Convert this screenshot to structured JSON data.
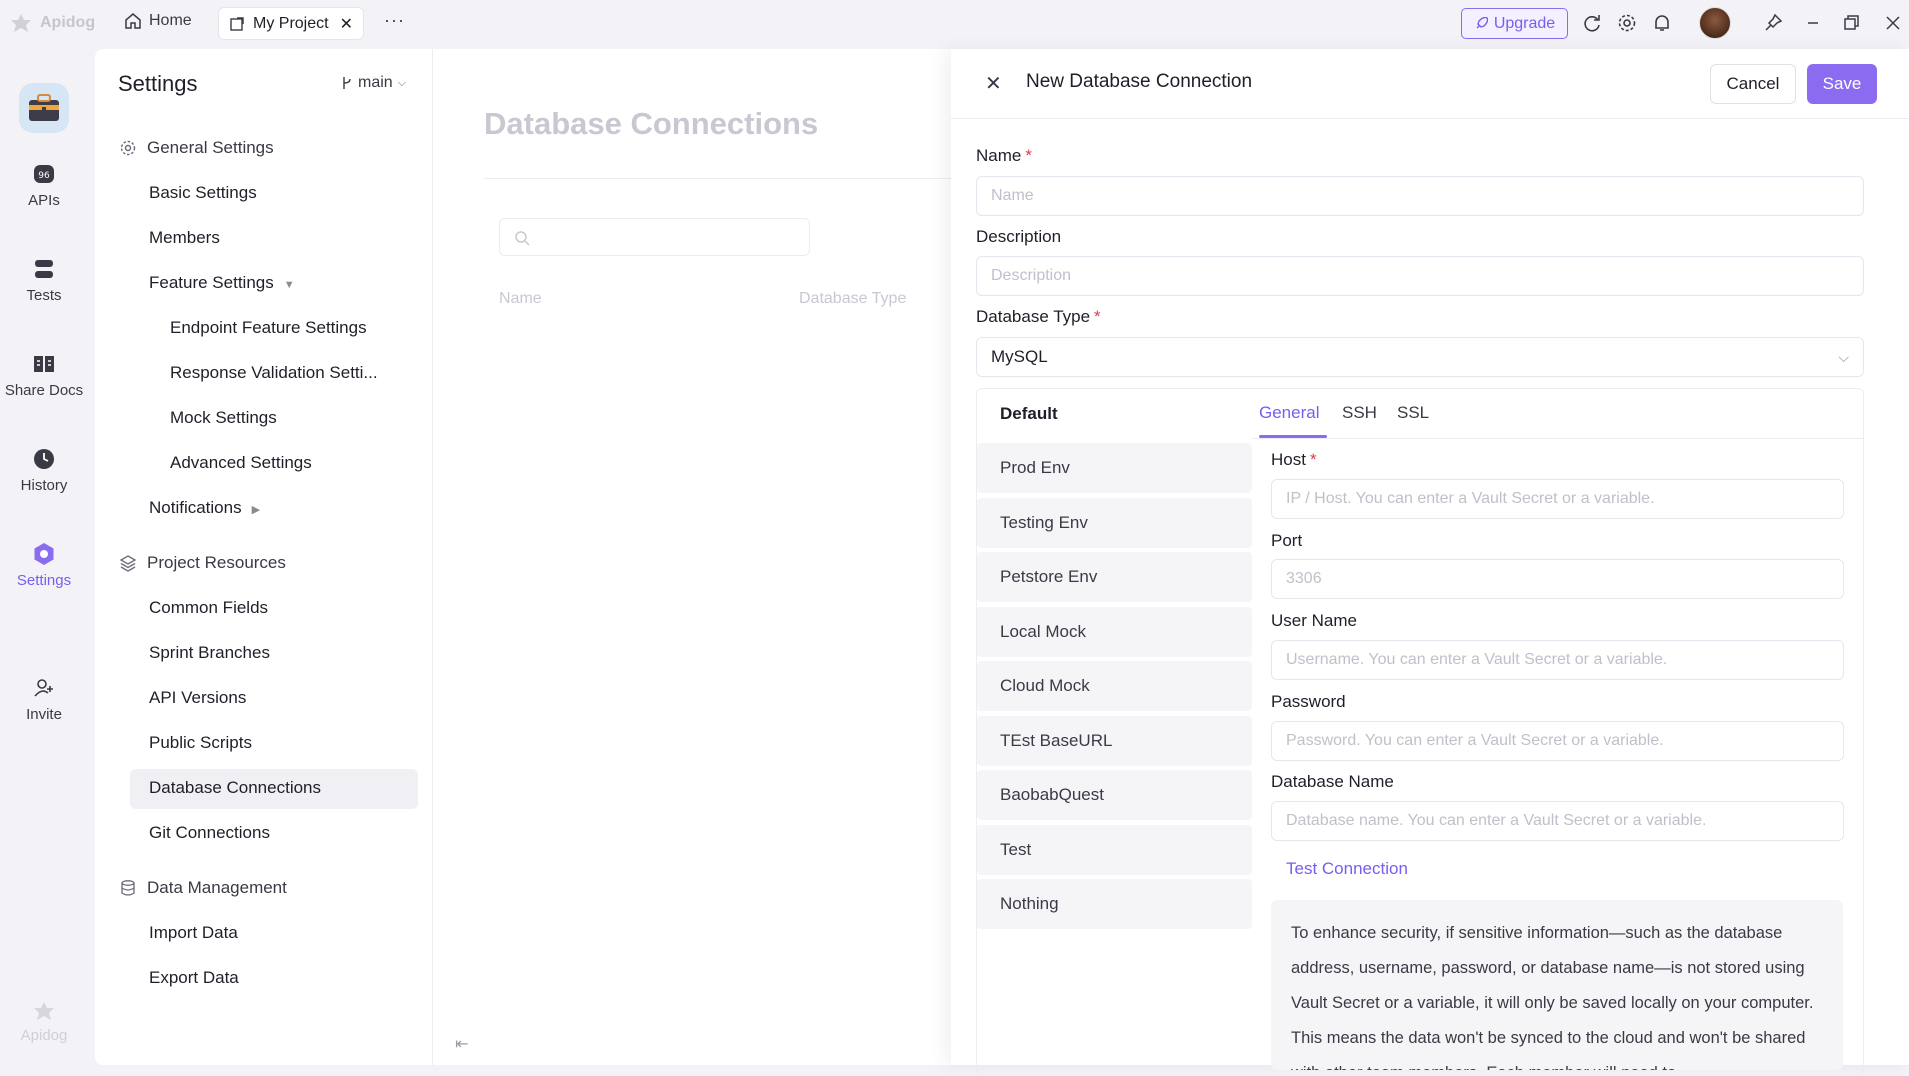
{
  "titlebar": {
    "logo_text": "Apidog",
    "home_label": "Home",
    "tab_label": "My Project",
    "tab_close": "✕",
    "more": "···",
    "upgrade_label": "Upgrade"
  },
  "rail": {
    "items": [
      {
        "label": "APIs",
        "icon": "apis-icon"
      },
      {
        "label": "Tests",
        "icon": "tests-icon"
      },
      {
        "label": "Share Docs",
        "icon": "share-docs-icon"
      },
      {
        "label": "History",
        "icon": "history-icon"
      },
      {
        "label": "Settings",
        "icon": "settings-icon",
        "active": true
      },
      {
        "label": "Invite",
        "icon": "invite-icon"
      }
    ],
    "bottom_logo": "Apidog"
  },
  "settings": {
    "title": "Settings",
    "branch": "main",
    "general_group": "General Settings",
    "general_items": [
      "Basic Settings",
      "Members",
      "Feature Settings"
    ],
    "feature_sub": [
      "Endpoint Feature Settings",
      "Response Validation Setti...",
      "Mock Settings",
      "Advanced Settings"
    ],
    "notifications": "Notifications",
    "resources_group": "Project Resources",
    "resources_items": [
      "Common Fields",
      "Sprint Branches",
      "API Versions",
      "Public Scripts",
      "Database Connections",
      "Git Connections"
    ],
    "data_group": "Data Management",
    "data_items": [
      "Import Data",
      "Export Data"
    ]
  },
  "background": {
    "title": "Database Connections",
    "col_name": "Name",
    "col_type": "Database Type"
  },
  "drawer": {
    "title": "New Database Connection",
    "cancel": "Cancel",
    "save": "Save",
    "name_label": "Name",
    "name_placeholder": "Name",
    "desc_label": "Description",
    "desc_placeholder": "Description",
    "dbtype_label": "Database Type",
    "dbtype_value": "MySQL",
    "env_head": "Default",
    "envs": [
      "Prod Env",
      "Testing Env",
      "Petstore Env",
      "Local Mock",
      "Cloud Mock",
      "TEst BaseURL",
      "BaobabQuest",
      "Test",
      "Nothing"
    ],
    "tabs": [
      "General",
      "SSH",
      "SSL"
    ],
    "host_label": "Host",
    "host_placeholder": "IP / Host. You can enter a Vault Secret or a variable.",
    "port_label": "Port",
    "port_placeholder": "3306",
    "user_label": "User Name",
    "user_placeholder": "Username. You can enter a Vault Secret or a variable.",
    "pass_label": "Password",
    "pass_placeholder": "Password. You can enter a Vault Secret or a variable.",
    "dbname_label": "Database Name",
    "dbname_placeholder": "Database name. You can enter a Vault Secret or a variable.",
    "test_connection": "Test Connection",
    "notice": "To enhance security, if sensitive information—such as the database address, username, password, or database name—is not stored using Vault Secret or a variable, it will only be saved locally on your computer. This means the data won't be synced to the cloud and won't be shared with other team members. Each member will need to"
  },
  "colors": {
    "accent": "#8b6cf0",
    "required": "#e0394f"
  }
}
